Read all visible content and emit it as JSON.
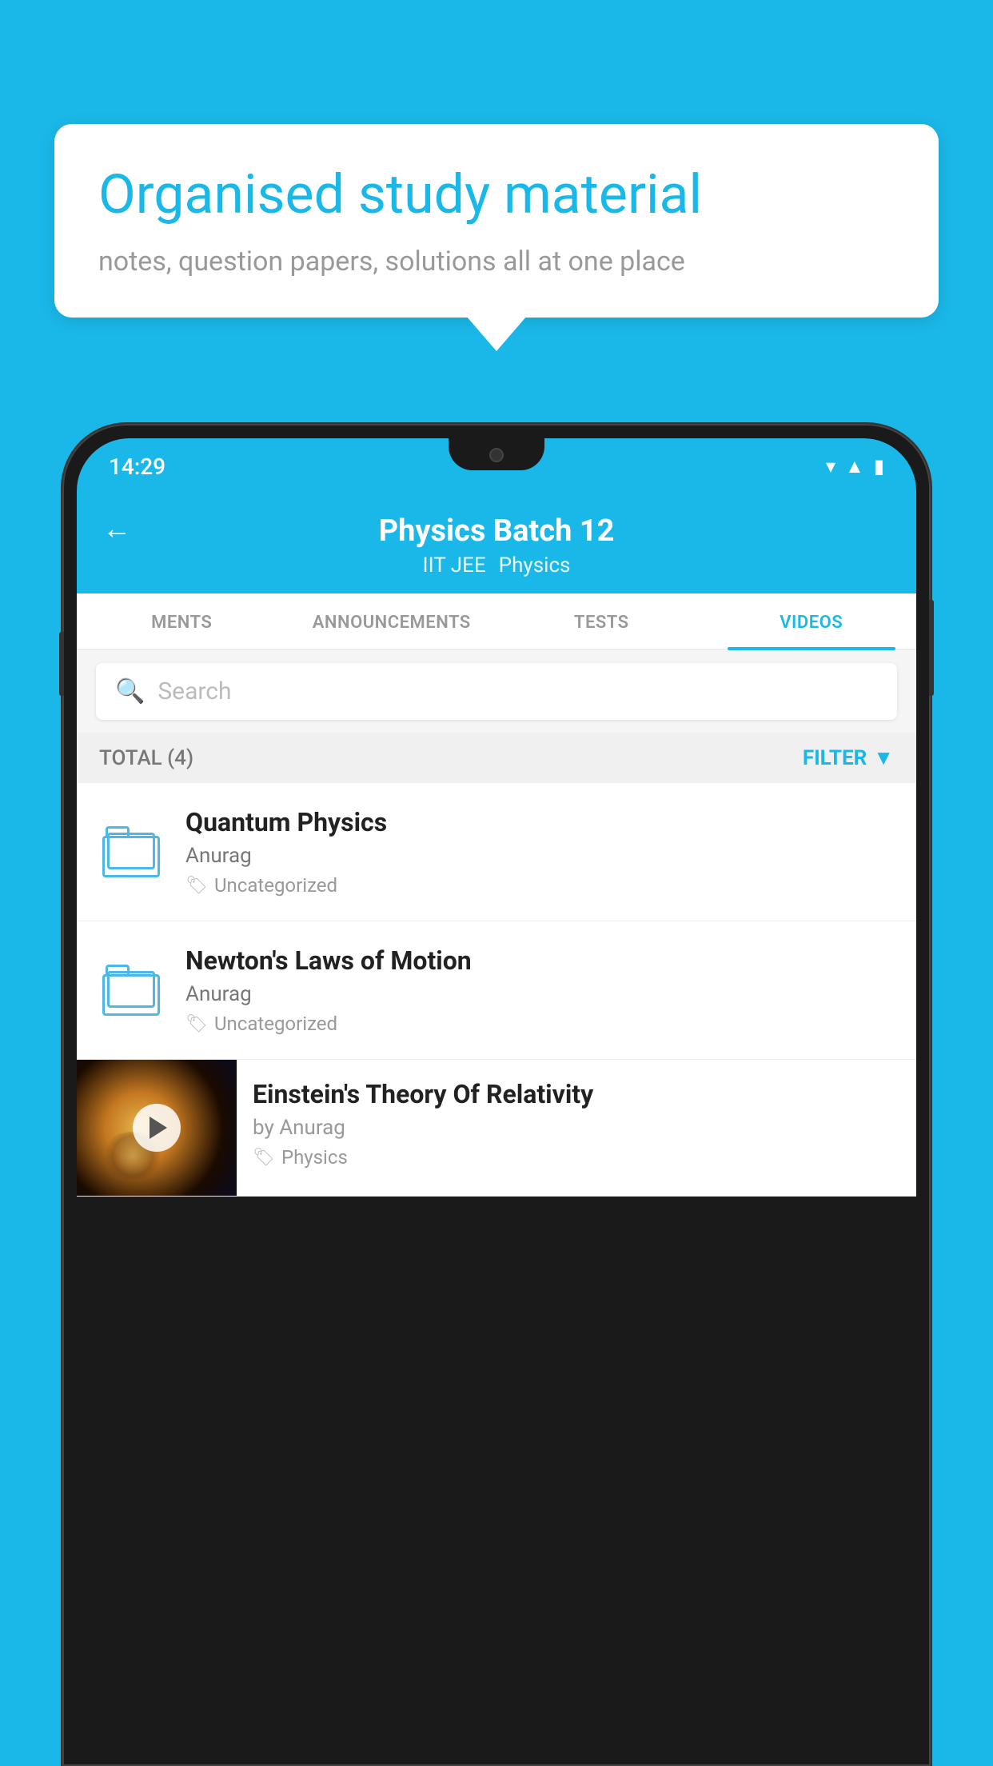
{
  "background_color": "#1ab8e8",
  "bubble": {
    "title": "Organised study material",
    "subtitle": "notes, question papers, solutions all at one place"
  },
  "phone": {
    "status_bar": {
      "time": "14:29",
      "icons": [
        "wifi",
        "signal",
        "battery"
      ]
    },
    "header": {
      "back_label": "←",
      "title": "Physics Batch 12",
      "subtitle_left": "IIT JEE",
      "subtitle_right": "Physics"
    },
    "tabs": [
      {
        "label": "MENTS",
        "active": false
      },
      {
        "label": "ANNOUNCEMENTS",
        "active": false
      },
      {
        "label": "TESTS",
        "active": false
      },
      {
        "label": "VIDEOS",
        "active": true
      }
    ],
    "search": {
      "placeholder": "Search"
    },
    "list_header": {
      "total": "TOTAL (4)",
      "filter": "FILTER"
    },
    "items": [
      {
        "title": "Quantum Physics",
        "author": "Anurag",
        "tag": "Uncategorized",
        "type": "folder"
      },
      {
        "title": "Newton's Laws of Motion",
        "author": "Anurag",
        "tag": "Uncategorized",
        "type": "folder"
      },
      {
        "title": "Einstein's Theory Of Relativity",
        "author": "by Anurag",
        "tag": "Physics",
        "type": "video"
      }
    ]
  }
}
